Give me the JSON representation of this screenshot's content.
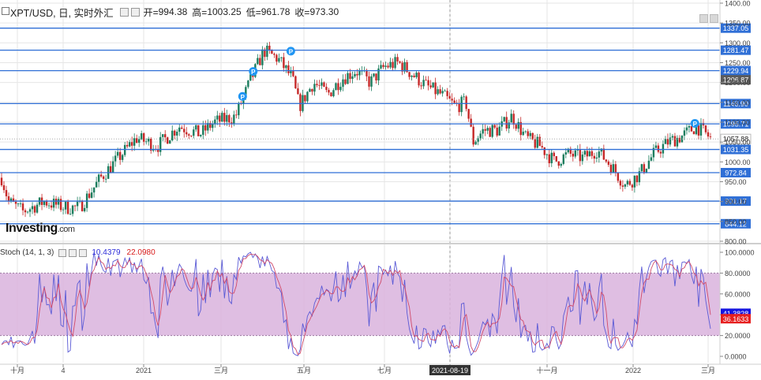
{
  "header": {
    "symbol": "XPT/USD, 日, 实时外汇",
    "open_label": "开=",
    "open": "994.38",
    "high_label": "高=",
    "high": "1003.25",
    "low_label": "低=",
    "low": "961.78",
    "close_label": "收=",
    "close": "973.30"
  },
  "stoch_header": {
    "name": "Stoch (14, 1, 3)",
    "k_value": "10.4379",
    "d_value": "22.0980"
  },
  "logo": {
    "main": "Investing",
    "suffix": ".com"
  },
  "colors": {
    "up": "#26a69a",
    "down": "#ef5350",
    "candle_body_up": "#1b7d5e",
    "candle_body_down": "#c62828",
    "hline": "#2f6fd6",
    "k_line": "#5b5bd6",
    "d_line": "#d14b6a",
    "stoch_band": "#d9b3dd",
    "grid": "#e6e6e6",
    "axis_text": "#444",
    "k_badge": "#1515e0",
    "d_badge": "#e62020",
    "price_badge": "#5a5a5a"
  },
  "chart_data": [
    {
      "type": "candlestick",
      "title": "XPT/USD, 日, 实时外汇",
      "ylim": [
        800,
        1400
      ],
      "y_ticks": [
        "1400.00",
        "1350.00",
        "1300.00",
        "1250.00",
        "1200.00",
        "1150.00",
        "1100.00",
        "1050.00",
        "1000.00",
        "950.00",
        "900.00",
        "850.00",
        "800.00"
      ],
      "x_labels": [
        "十月",
        "4",
        "2021",
        "三月",
        "五月",
        "七月",
        "2021-08-19",
        "十一月",
        "2022",
        "三月"
      ],
      "horizontal_levels": [
        "1337.05",
        "1281.47",
        "1229.94",
        "1146.90",
        "1095.71",
        "1031.35",
        "972.84",
        "901.17",
        "844.12"
      ],
      "price_badges": [
        {
          "label": "1206.87",
          "value": 1206.87,
          "style": "dark"
        },
        {
          "label": "1057.88",
          "value": 1057.88,
          "style": "light"
        }
      ],
      "marker_label": "P",
      "markers": [
        {
          "x": 0.34,
          "value": 1165
        },
        {
          "x": 0.355,
          "value": 1228
        },
        {
          "x": 0.408,
          "value": 1279
        },
        {
          "x": 0.978,
          "value": 1097
        }
      ],
      "trend": [
        {
          "t": 0.0,
          "v": 960
        },
        {
          "t": 0.01,
          "v": 900
        },
        {
          "t": 0.03,
          "v": 875
        },
        {
          "t": 0.06,
          "v": 900
        },
        {
          "t": 0.09,
          "v": 885
        },
        {
          "t": 0.11,
          "v": 885
        },
        {
          "t": 0.14,
          "v": 960
        },
        {
          "t": 0.16,
          "v": 1000
        },
        {
          "t": 0.19,
          "v": 1060
        },
        {
          "t": 0.22,
          "v": 1040
        },
        {
          "t": 0.25,
          "v": 1090
        },
        {
          "t": 0.28,
          "v": 1070
        },
        {
          "t": 0.3,
          "v": 1100
        },
        {
          "t": 0.33,
          "v": 1115
        },
        {
          "t": 0.35,
          "v": 1200
        },
        {
          "t": 0.37,
          "v": 1280
        },
        {
          "t": 0.39,
          "v": 1260
        },
        {
          "t": 0.41,
          "v": 1210
        },
        {
          "t": 0.42,
          "v": 1140
        },
        {
          "t": 0.44,
          "v": 1200
        },
        {
          "t": 0.46,
          "v": 1170
        },
        {
          "t": 0.48,
          "v": 1210
        },
        {
          "t": 0.5,
          "v": 1230
        },
        {
          "t": 0.52,
          "v": 1200
        },
        {
          "t": 0.54,
          "v": 1240
        },
        {
          "t": 0.56,
          "v": 1250
        },
        {
          "t": 0.58,
          "v": 1220
        },
        {
          "t": 0.6,
          "v": 1190
        },
        {
          "t": 0.62,
          "v": 1170
        },
        {
          "t": 0.64,
          "v": 1140
        },
        {
          "t": 0.655,
          "v": 1150
        },
        {
          "t": 0.665,
          "v": 1050
        },
        {
          "t": 0.68,
          "v": 1080
        },
        {
          "t": 0.7,
          "v": 1080
        },
        {
          "t": 0.72,
          "v": 1115
        },
        {
          "t": 0.74,
          "v": 1060
        },
        {
          "t": 0.76,
          "v": 1040
        },
        {
          "t": 0.78,
          "v": 1000
        },
        {
          "t": 0.8,
          "v": 1020
        },
        {
          "t": 0.82,
          "v": 1010
        },
        {
          "t": 0.84,
          "v": 1030
        },
        {
          "t": 0.86,
          "v": 990
        },
        {
          "t": 0.88,
          "v": 940
        },
        {
          "t": 0.9,
          "v": 970
        },
        {
          "t": 0.92,
          "v": 1020
        },
        {
          "t": 0.94,
          "v": 1050
        },
        {
          "t": 0.96,
          "v": 1065
        },
        {
          "t": 0.98,
          "v": 1090
        },
        {
          "t": 1.0,
          "v": 1060
        }
      ]
    },
    {
      "type": "line",
      "title": "Stoch (14, 1, 3)",
      "ylim": [
        0,
        100
      ],
      "y_ticks": [
        "100.0000",
        "80.0000",
        "60.0000",
        "40.0000",
        "20.0000",
        "0.0000"
      ],
      "band": [
        20,
        80
      ],
      "series": [
        {
          "name": "10.4379",
          "badge": "41.3828"
        },
        {
          "name": "22.0980",
          "badge": "36.1633"
        }
      ]
    }
  ]
}
